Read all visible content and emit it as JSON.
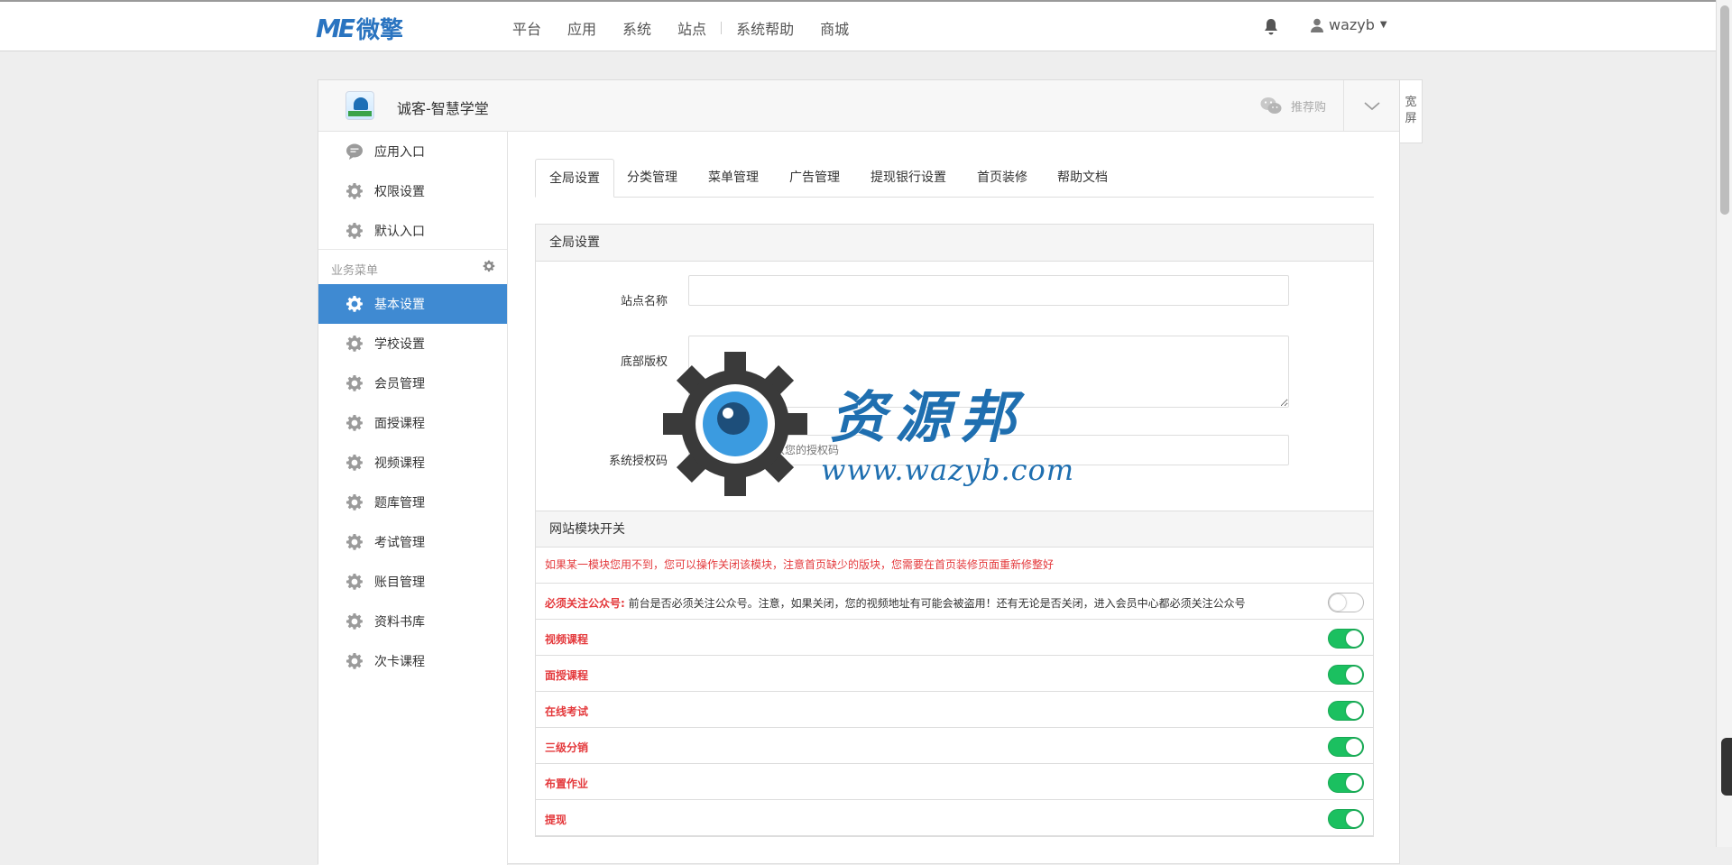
{
  "topbar": {
    "logo_mark": "ME",
    "logo_text": "微擎",
    "nav": [
      "平台",
      "应用",
      "系统",
      "站点",
      "系统帮助",
      "商城"
    ],
    "user": "wazyb"
  },
  "panel": {
    "app_title": "诚客-智慧学堂",
    "share_label": "推荐购",
    "wide_label": "宽屏"
  },
  "sidebar": {
    "top_items": [
      {
        "label": "应用入口",
        "icon": "chat-icon"
      },
      {
        "label": "权限设置",
        "icon": "gear-icon"
      },
      {
        "label": "默认入口",
        "icon": "gear-icon"
      }
    ],
    "section_label": "业务菜单",
    "items": [
      {
        "label": "基本设置",
        "active": true
      },
      {
        "label": "学校设置"
      },
      {
        "label": "会员管理"
      },
      {
        "label": "面授课程"
      },
      {
        "label": "视频课程"
      },
      {
        "label": "题库管理"
      },
      {
        "label": "考试管理"
      },
      {
        "label": "账目管理"
      },
      {
        "label": "资料书库"
      },
      {
        "label": "次卡课程"
      }
    ]
  },
  "tabs": [
    "全局设置",
    "分类管理",
    "菜单管理",
    "广告管理",
    "提现银行设置",
    "首页装修",
    "帮助文档"
  ],
  "global": {
    "heading": "全局设置",
    "site_name_label": "站点名称",
    "site_name_value": "",
    "copyright_label": "底部版权",
    "copyright_value": "",
    "auth_label": "系统授权码",
    "auth_placeholder": "请联系开发者获取您的授权码"
  },
  "modules": {
    "heading": "网站模块开关",
    "notice": "如果某一模块您用不到，您可以操作关闭该模块，注意首页缺少的版块，您需要在首页装修页面重新修整好",
    "rows": [
      {
        "label": "必须关注公众号:",
        "desc": " 前台是否必须关注公众号。注意，如果关闭，您的视频地址有可能会被盗用！还有无论是否关闭，进入会员中心都必须关注公众号",
        "on": false
      },
      {
        "label": "视频课程",
        "on": true
      },
      {
        "label": "面授课程",
        "on": true
      },
      {
        "label": "在线考试",
        "on": true
      },
      {
        "label": "三级分销",
        "on": true
      },
      {
        "label": "布置作业",
        "on": true
      },
      {
        "label": "提现",
        "on": true
      }
    ]
  },
  "watermark": {
    "text": "资源邦",
    "url": "www.wazyb.com"
  },
  "colors": {
    "brand": "#2a74c0",
    "sidebar_active": "#3f8ad2",
    "toggle_on": "#1bc060",
    "notice_red": "#e4393c"
  }
}
